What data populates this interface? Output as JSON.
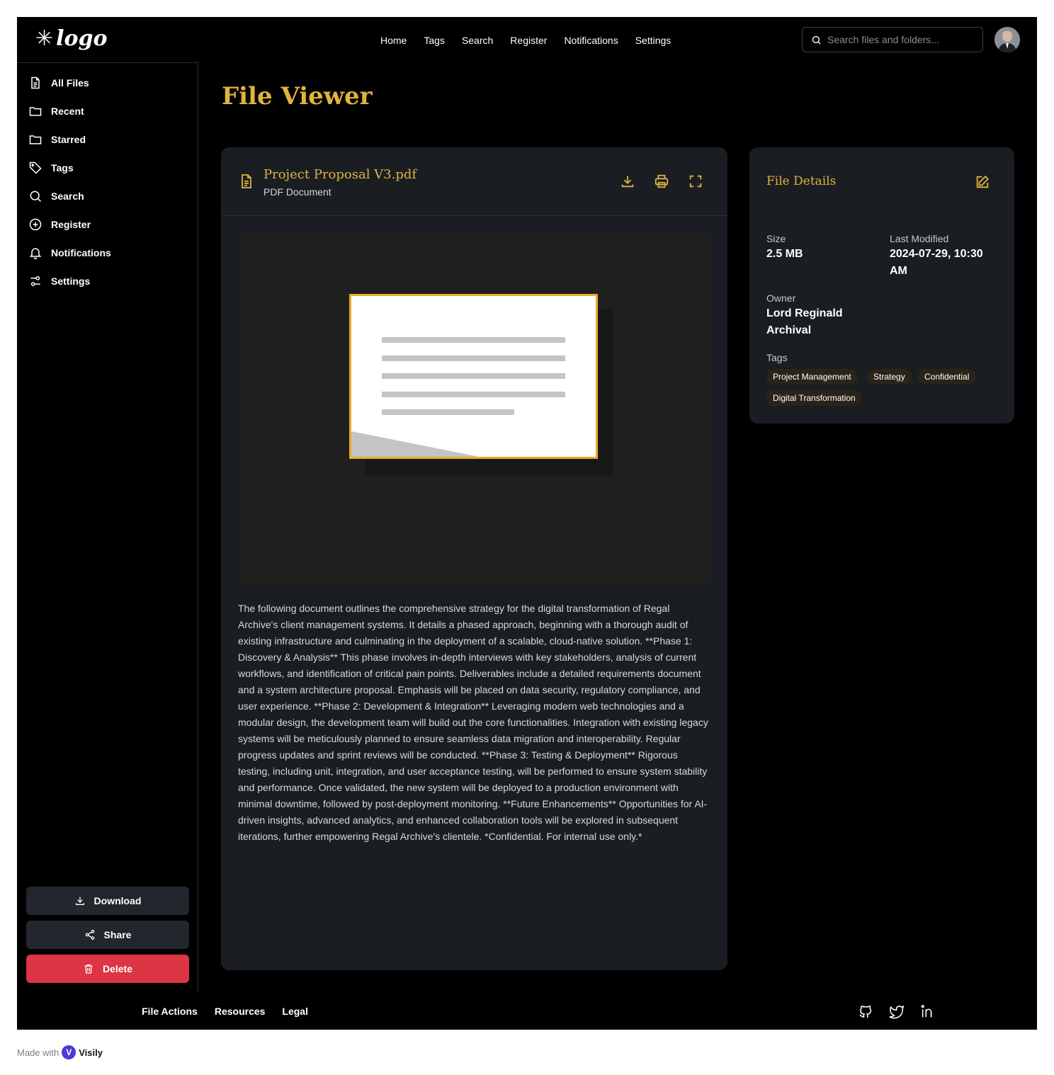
{
  "header": {
    "logo_text": "logo",
    "nav": [
      "Home",
      "Tags",
      "Search",
      "Register",
      "Notifications",
      "Settings"
    ],
    "search_placeholder": "Search files and folders..."
  },
  "sidebar": {
    "items": [
      {
        "label": "All Files",
        "icon": "file-icon"
      },
      {
        "label": "Recent",
        "icon": "folder-icon"
      },
      {
        "label": "Starred",
        "icon": "folder-icon"
      },
      {
        "label": "Tags",
        "icon": "tag-icon"
      },
      {
        "label": "Search",
        "icon": "search-icon"
      },
      {
        "label": "Register",
        "icon": "plus-circle-icon"
      },
      {
        "label": "Notifications",
        "icon": "bell-icon"
      },
      {
        "label": "Settings",
        "icon": "sliders-icon"
      }
    ],
    "download_label": "Download",
    "share_label": "Share",
    "delete_label": "Delete"
  },
  "page": {
    "title": "File Viewer"
  },
  "viewer": {
    "file_name": "Project Proposal V3.pdf",
    "file_type": "PDF Document",
    "body": "The following document outlines the comprehensive strategy for the digital transformation of Regal Archive's client management systems. It details a phased approach, beginning with a thorough audit of existing infrastructure and culminating in the deployment of a scalable, cloud-native solution. **Phase 1: Discovery & Analysis** This phase involves in-depth interviews with key stakeholders, analysis of current workflows, and identification of critical pain points. Deliverables include a detailed requirements document and a system architecture proposal. Emphasis will be placed on data security, regulatory compliance, and user experience. **Phase 2: Development & Integration** Leveraging modern web technologies and a modular design, the development team will build out the core functionalities. Integration with existing legacy systems will be meticulously planned to ensure seamless data migration and interoperability. Regular progress updates and sprint reviews will be conducted. **Phase 3: Testing & Deployment** Rigorous testing, including unit, integration, and user acceptance testing, will be performed to ensure system stability and performance. Once validated, the new system will be deployed to a production environment with minimal downtime, followed by post-deployment monitoring. **Future Enhancements** Opportunities for AI-driven insights, advanced analytics, and enhanced collaboration tools will be explored in subsequent iterations, further empowering Regal Archive's clientele. *Confidential. For internal use only.*"
  },
  "details": {
    "title": "File Details",
    "size_label": "Size",
    "size_value": "2.5 MB",
    "modified_label": "Last Modified",
    "modified_value": "2024-07-29, 10:30 AM",
    "owner_label": "Owner",
    "owner_value": "Lord Reginald Archival",
    "tags_label": "Tags",
    "tags": [
      "Project Management",
      "Strategy",
      "Confidential",
      "Digital Transformation"
    ]
  },
  "footer": {
    "links": [
      "File Actions",
      "Resources",
      "Legal"
    ],
    "social_icons": [
      "github-icon",
      "twitter-icon",
      "linkedin-icon"
    ]
  },
  "watermark": {
    "made_with": "Made with",
    "brand": "Visily"
  },
  "colors": {
    "accent_gold": "#e0b33e",
    "delete_red": "#dc3545",
    "card_bg": "#1a1d22"
  }
}
